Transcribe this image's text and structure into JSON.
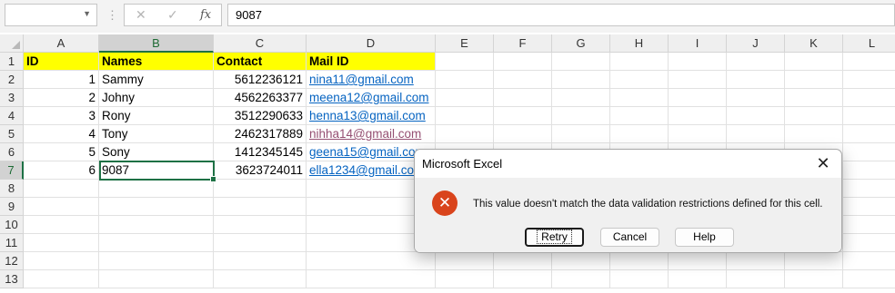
{
  "formula_bar": {
    "name_box_value": "",
    "cancel_glyph": "✕",
    "enter_glyph": "✓",
    "fx_glyph": "fx",
    "formula_value": "9087"
  },
  "columns": [
    "A",
    "B",
    "C",
    "D",
    "E",
    "F",
    "G",
    "H",
    "I",
    "J",
    "K",
    "L"
  ],
  "rows": [
    "1",
    "2",
    "3",
    "4",
    "5",
    "6",
    "7",
    "8",
    "9",
    "10",
    "11",
    "12",
    "13"
  ],
  "table": {
    "headers": [
      "ID",
      "Names",
      "Contact",
      "Mail ID"
    ],
    "rows": [
      [
        "1",
        "Sammy",
        "5612236121",
        "nina11@gmail.com"
      ],
      [
        "2",
        "Johny",
        "4562263377",
        "meena12@gmail.com"
      ],
      [
        "3",
        "Rony",
        "3512290633",
        "henna13@gmail.com"
      ],
      [
        "4",
        "Tony",
        "2462317889",
        "nihha14@gmail.com"
      ],
      [
        "5",
        "Sony",
        "1412345145",
        "geena15@gmail.com"
      ],
      [
        "6",
        "9087",
        "3623724011",
        "ella1234@gmail.com"
      ]
    ]
  },
  "selection": {
    "cell": "B7"
  },
  "dialog": {
    "title": "Microsoft Excel",
    "close_glyph": "✕",
    "icon_glyph": "✕",
    "message": "This value doesn't match the data validation restrictions defined for this cell.",
    "buttons": {
      "retry": "Retry",
      "cancel": "Cancel",
      "help": "Help"
    }
  },
  "colors": {
    "header_fill": "#ffff00",
    "hyperlink": "#0563c1",
    "visited_link": "#954f72",
    "selection": "#1e7145",
    "error_icon": "#d9441c"
  }
}
